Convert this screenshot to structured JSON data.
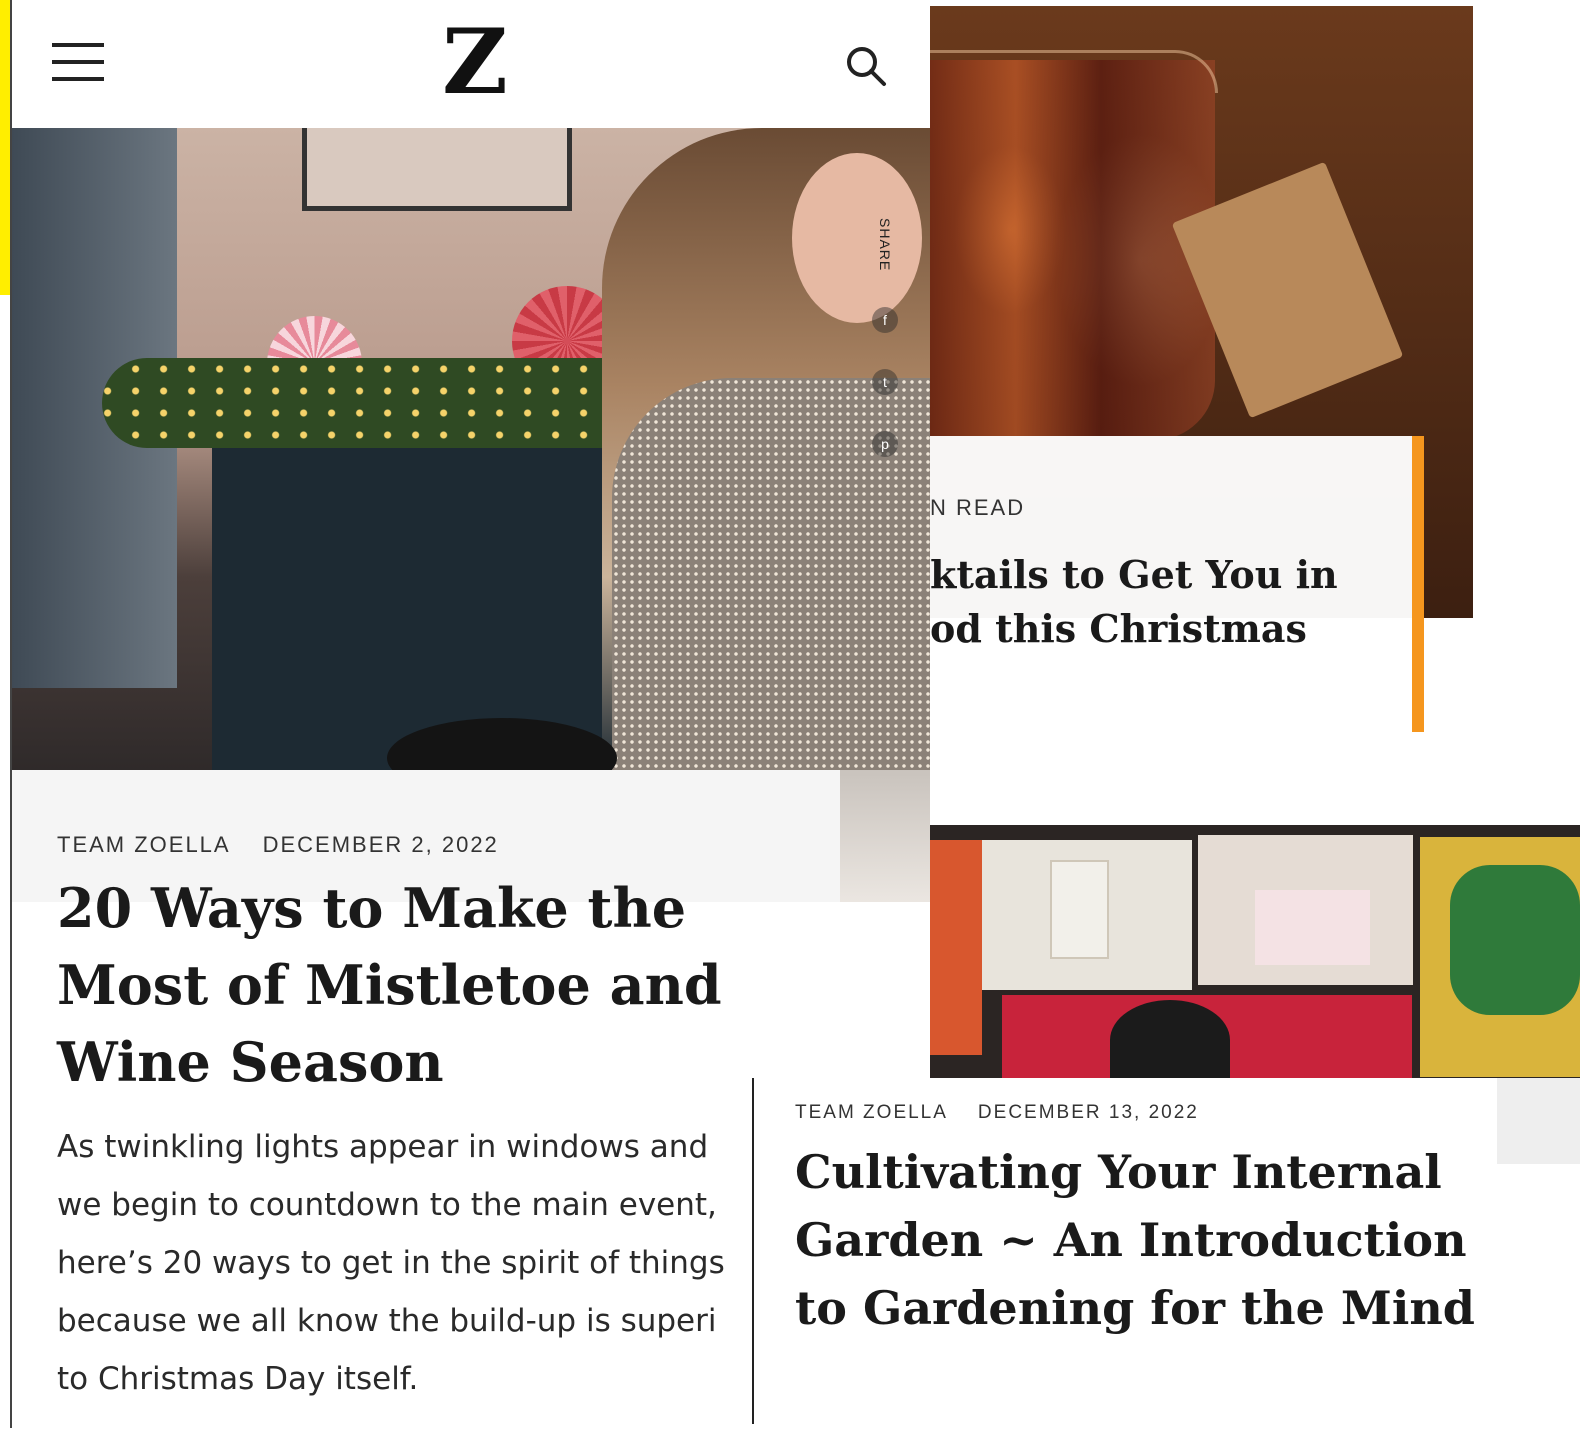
{
  "site": {
    "logo": "Z"
  },
  "header": {
    "menu_icon": "hamburger-menu-icon",
    "search_icon": "search-icon"
  },
  "main_article": {
    "author": "TEAM ZOELLA",
    "date": "DECEMBER 2, 2022",
    "title": "20 Ways to Make the Most of Mistletoe and Wine Season",
    "excerpt": "As twinkling lights appear in windows and\nwe begin to countdown to the main event,\nhere’s 20 ways to get in the spirit of things\nbecause we all know the build-up is superi\nto Christmas Day itself.",
    "share_label": "SHARE",
    "social_icons": [
      "facebook-icon",
      "twitter-icon",
      "pinterest-icon"
    ]
  },
  "cocktail_article": {
    "meta": "N READ",
    "title": "ktails to Get You in\nod this Christmas",
    "accent_color": "#f5961e"
  },
  "garden_article": {
    "author": "TEAM ZOELLA",
    "date": "DECEMBER 13, 2022",
    "title": "Cultivating Your Internal Garden ~ An Introduction to Gardening for the Mind"
  },
  "colors": {
    "highlight": "#ffee00",
    "text": "#1a1a1a"
  }
}
